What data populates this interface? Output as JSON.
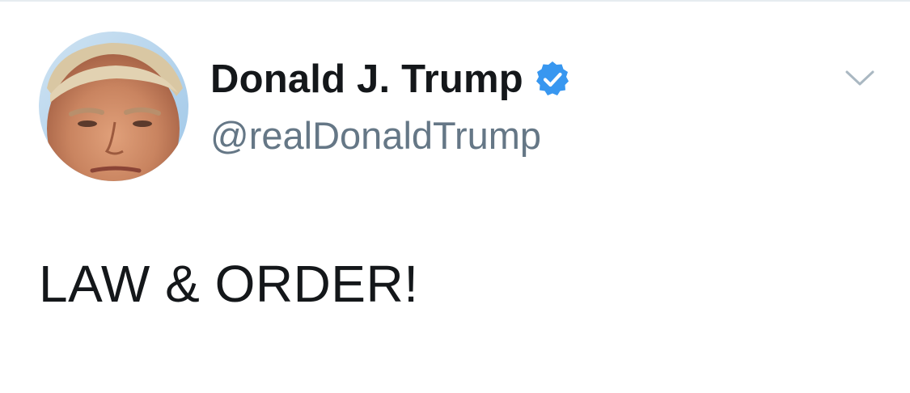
{
  "author": {
    "display_name": "Donald J. Trump",
    "handle": "@realDonaldTrump",
    "verified": true,
    "verified_icon": "verified-badge-icon",
    "verified_color": "#3897f0"
  },
  "menu": {
    "icon": "chevron-down-icon"
  },
  "tweet": {
    "text": "LAW & ORDER!"
  },
  "colors": {
    "text_primary": "#14171a",
    "text_secondary": "#657786",
    "caret": "#aab8c2"
  }
}
